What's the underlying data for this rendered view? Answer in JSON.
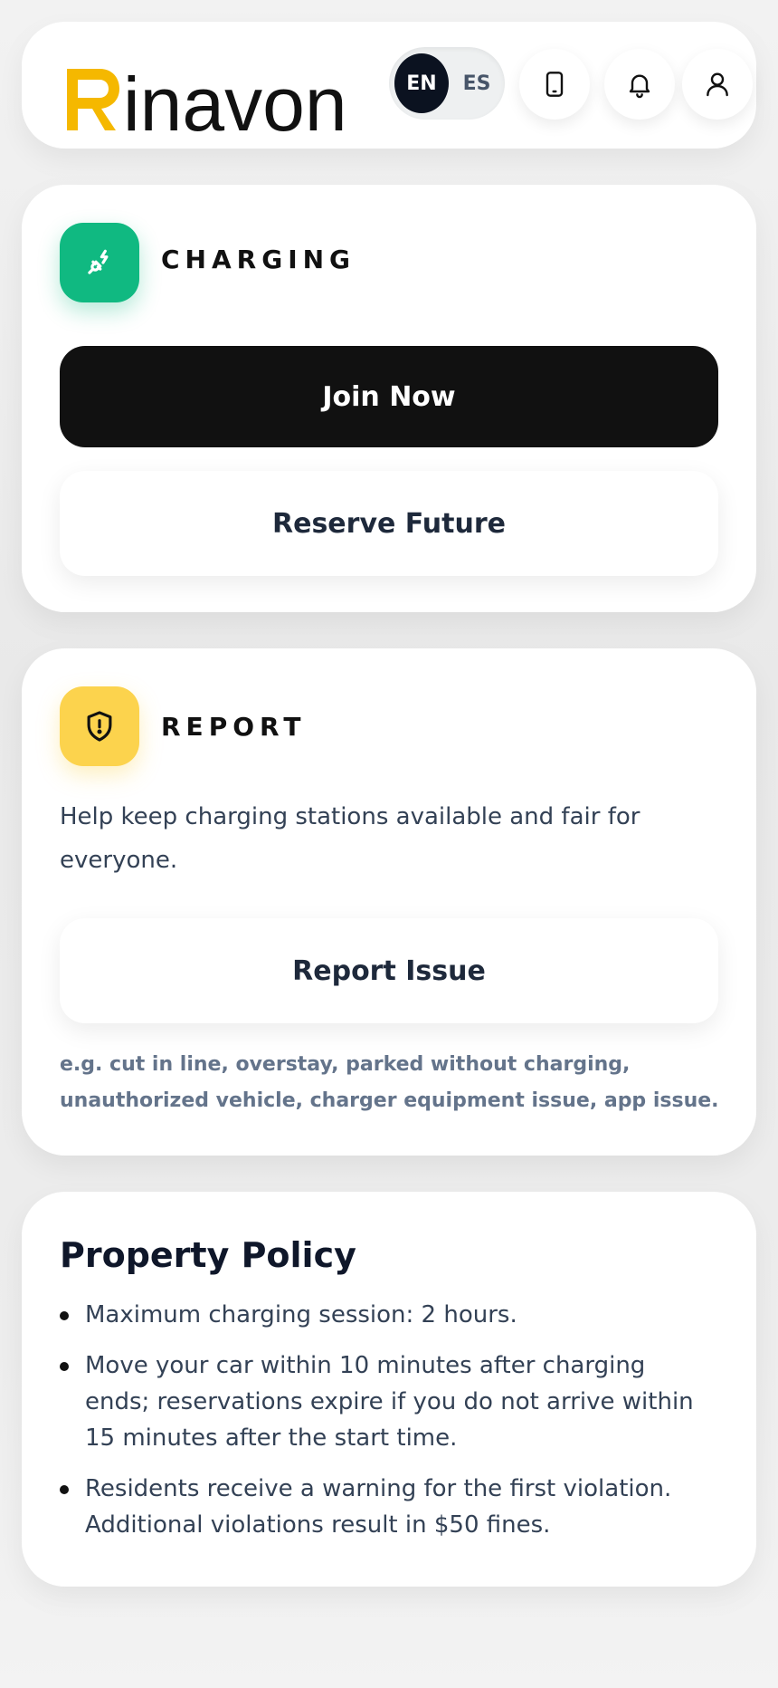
{
  "header": {
    "logo_text": "Rinavon",
    "language": {
      "en": "EN",
      "es": "ES",
      "selected": "EN"
    },
    "icons": [
      "phone-icon",
      "bell-icon",
      "user-icon"
    ]
  },
  "charging": {
    "title": "CHARGING",
    "icon": "plug-icon",
    "join_label": "Join Now",
    "reserve_label": "Reserve Future"
  },
  "report": {
    "title": "REPORT",
    "icon": "shield-alert-icon",
    "description": "Help keep charging stations available and fair for everyone.",
    "button_label": "Report Issue",
    "hint": "e.g. cut in line, overstay, parked without charging, unauthorized vehicle, charger equipment issue, app issue."
  },
  "policy": {
    "title": "Property Policy",
    "items": [
      "Maximum charging session: 2 hours.",
      "Move your car within 10 minutes after charging ends; reservations expire if you do not arrive within 15 minutes after the start time.",
      "Residents receive a warning for the first violation. Additional violations result in $50 fines."
    ]
  },
  "colors": {
    "accent_yellow": "#f5b800",
    "charging_green": "#10b981",
    "report_yellow": "#fcd34d",
    "dark": "#111111"
  }
}
